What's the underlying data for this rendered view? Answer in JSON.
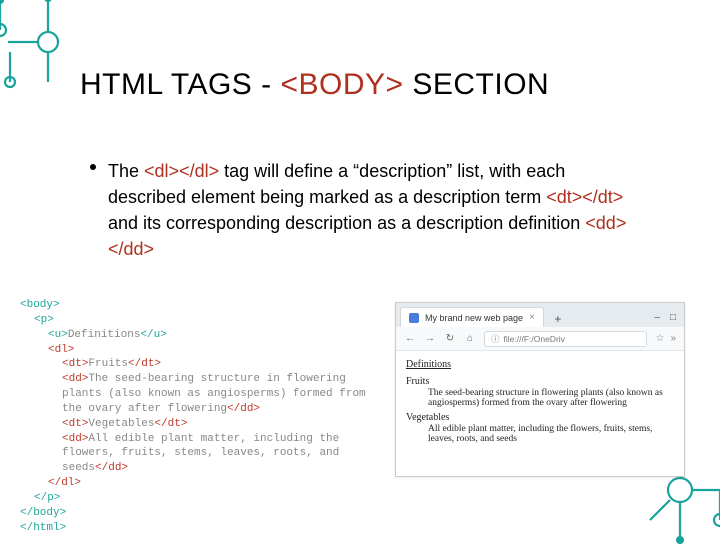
{
  "title": {
    "pre": "HTML TAGS - ",
    "tag": "<BODY>",
    "post": " SECTION"
  },
  "bullet": {
    "p1": "The ",
    "tag_dl": "<dl></dl>",
    "p2": " tag will define a “description” list, with each described element being marked as a description term ",
    "tag_dt": "<dt></dt>",
    "p3": " and its corresponding description as a description definition ",
    "tag_dd": "<dd></dd>"
  },
  "code": {
    "l1": "<body>",
    "l2": "<p>",
    "l3a": "<u>",
    "l3b": "Definitions",
    "l3c": "</u>",
    "l4": "<dl>",
    "l5a": "<dt>",
    "l5b": "Fruits",
    "l5c": "</dt>",
    "l6a": "<dd>",
    "l6b": "The seed-bearing structure in flowering plants (also known as angiosperms) formed from the ovary after flowering",
    "l6c": "</dd>",
    "l7a": "<dt>",
    "l7b": "Vegetables",
    "l7c": "</dt>",
    "l8a": "<dd>",
    "l8b": "All edible plant matter, including the flowers, fruits, stems, leaves, roots, and seeds",
    "l8c": "</dd>",
    "l9": "</dl>",
    "l10": "</p>",
    "l11": "</body>",
    "l12": "</html>"
  },
  "browser": {
    "tab_title": "My brand new web page",
    "url": "file:///F:/OneDriv",
    "content": {
      "heading": "Definitions",
      "term1": "Fruits",
      "def1": "The seed-bearing structure in flowering plants (also known as angiosperms) formed from the ovary after flowering",
      "term2": "Vegetables",
      "def2": "All edible plant matter, including the flowers, fruits, stems, leaves, roots, and seeds"
    }
  },
  "icons": {
    "close": "×",
    "plus": "+",
    "min": "–",
    "max": "□",
    "back": "←",
    "fwd": "→",
    "reload": "↻",
    "home": "⌂",
    "info": "ⓘ",
    "star": "☆",
    "menu": "»"
  }
}
